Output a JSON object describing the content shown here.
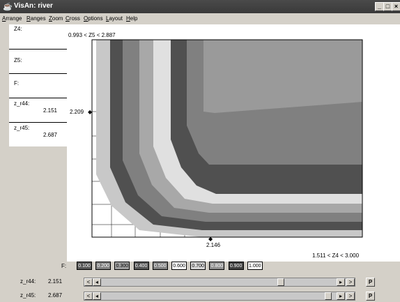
{
  "window": {
    "title": "VisAn: river",
    "min": "_",
    "max": "□",
    "close": "×"
  },
  "menu": [
    "Arrange",
    "Ranges",
    "Zoom",
    "Cross",
    "Options",
    "Layout",
    "Help"
  ],
  "panel": {
    "z4": "Z4:",
    "z5": "Z5:",
    "f": "F:",
    "zr44": {
      "label": "z_r44:",
      "value": "2.151"
    },
    "zr45": {
      "label": "z_r45:",
      "value": "2.687"
    }
  },
  "plot": {
    "range_y": "0.993 < Z5 < 2.887",
    "range_x": "1.511 < Z4 < 3.000",
    "cursor_y": "2.209",
    "cursor_x": "2.146"
  },
  "legend": {
    "label": "F:",
    "levels": [
      "0.100",
      "0.200",
      "0.300",
      "0.400",
      "0.500",
      "0.600",
      "0.700",
      "0.800",
      "0.900",
      "1.000"
    ],
    "colors": [
      "#575757",
      "#808080",
      "#a0a0a0",
      "#575757",
      "#808080",
      "#ffffff",
      "#d8d8d8",
      "#909090",
      "#404040",
      "#ffffff"
    ]
  },
  "sliders": [
    {
      "label": "z_r44:",
      "value": "2.151",
      "position": 0.77,
      "end_left": "▶",
      "end_right": "›",
      "p": "P"
    },
    {
      "label": "z_r45:",
      "value": "2.687",
      "position": 0.98,
      "end_left": "▶",
      "end_right": "›",
      "p": "P"
    }
  ]
}
